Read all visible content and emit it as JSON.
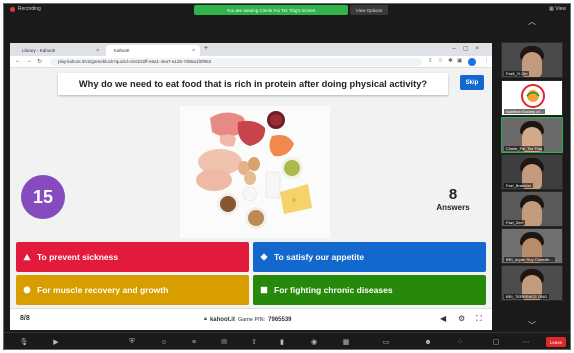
{
  "zoom": {
    "recording_label": "Recording",
    "share_banner": "You are viewing Cinnie Fai Tsz Ting's screen",
    "view_options_label": "View Options",
    "view_label": "View",
    "leave_label": "Leave",
    "colors": {
      "bg": "#1a1a1a",
      "share_green": "#2fb34a",
      "leave_red": "#e02828"
    }
  },
  "browser": {
    "tabs": [
      {
        "label": "Library - Kahoot!"
      },
      {
        "label": "Kahoot!"
      }
    ],
    "address": "play.kahoot.it/v2/gameblock?quizId=0c6222ff-e6a1-4ea7-a135-7d65a1f0f962"
  },
  "kahoot": {
    "question": "Why do we need to eat food that is rich in protein after doing physical activity?",
    "skip_label": "Skip",
    "timer": "15",
    "answers_count": "8",
    "answers_label": "Answers",
    "options": [
      {
        "label": "To prevent sickness",
        "shape": "triangle-icon"
      },
      {
        "label": "To satisfy our appetite",
        "shape": "diamond-icon"
      },
      {
        "label": "For muscle recovery and growth",
        "shape": "circle-icon"
      },
      {
        "label": "For fighting chronic diseases",
        "shape": "square-icon"
      }
    ],
    "counter": "8/8",
    "site": "kahoot.it",
    "pin_label": "Game PIN:",
    "pin": "7965539",
    "colors": {
      "red": "#e21b3c",
      "blue": "#1368ce",
      "yellow": "#d89e00",
      "green": "#26890c",
      "purple": "#864cbf"
    }
  },
  "participants": [
    {
      "name": "Fazli_Yi Qin"
    },
    {
      "name": "Nutrition Society of..."
    },
    {
      "name": "Cinnie_Fai_Tsz Ting"
    },
    {
      "name": "Fazl_Brandon"
    },
    {
      "name": "Fazl_Zee"
    },
    {
      "name": "BRI_Aryan Roy Chowdh..."
    },
    {
      "name": "BRI_TERRENCE ONG"
    }
  ]
}
